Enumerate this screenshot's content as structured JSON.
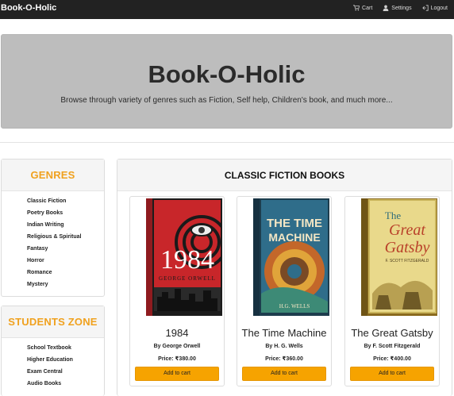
{
  "navbar": {
    "brand": "Book-O-Holic",
    "links": [
      {
        "label": "Cart",
        "icon": "cart-icon"
      },
      {
        "label": "Settings",
        "icon": "user-icon"
      },
      {
        "label": "Logout",
        "icon": "logout-icon"
      }
    ]
  },
  "jumbotron": {
    "title": "Book-O-Holic",
    "subtitle": "Browse through variety of genres such as Fiction, Self help, Children's book, and much more..."
  },
  "genres": {
    "heading": "GENRES",
    "items": [
      "Classic Fiction",
      "Poetry Books",
      "Indian Writing",
      "Religious & Spiritual",
      "Fantasy",
      "Horror",
      "Romance",
      "Mystery"
    ]
  },
  "students_zone": {
    "heading": "STUDENTS ZONE",
    "items": [
      "School Textbook",
      "Higher Education",
      "Exam Central",
      "Audio Books"
    ]
  },
  "main": {
    "heading": "CLASSIC FICTION BOOKS",
    "books": [
      {
        "title": "1984",
        "author": "By George Orwell",
        "price": "Price: ₹380.00",
        "button": "Add to cart",
        "cover": {
          "line1": "1984",
          "line2": "GEORGE ORWELL",
          "bg": "#c8262a",
          "accent": "#1a1a1a"
        }
      },
      {
        "title": "The Time Machine",
        "author": "By H. G. Wells",
        "price": "Price: ₹360.00",
        "button": "Add to cart",
        "cover": {
          "line1": "THE TIME",
          "line2": "MACHINE",
          "line3": "H.G. WELLS",
          "bg": "#2f6d8a",
          "accent": "#e0a43a"
        }
      },
      {
        "title": "The Great Gatsby",
        "author": "By F. Scott Fitzgerald",
        "price": "Price: ₹400.00",
        "button": "Add to cart",
        "cover": {
          "line1": "The",
          "line2": "Great",
          "line3": "Gatsby",
          "line4": "F. SCOTT FITZGERALD",
          "bg": "#e9d98b",
          "accent": "#b9412a"
        }
      }
    ]
  },
  "colors": {
    "accent": "#f0a11e",
    "button": "#f6a300",
    "navbar": "#222222",
    "jumbotron": "#bdbdbd"
  }
}
